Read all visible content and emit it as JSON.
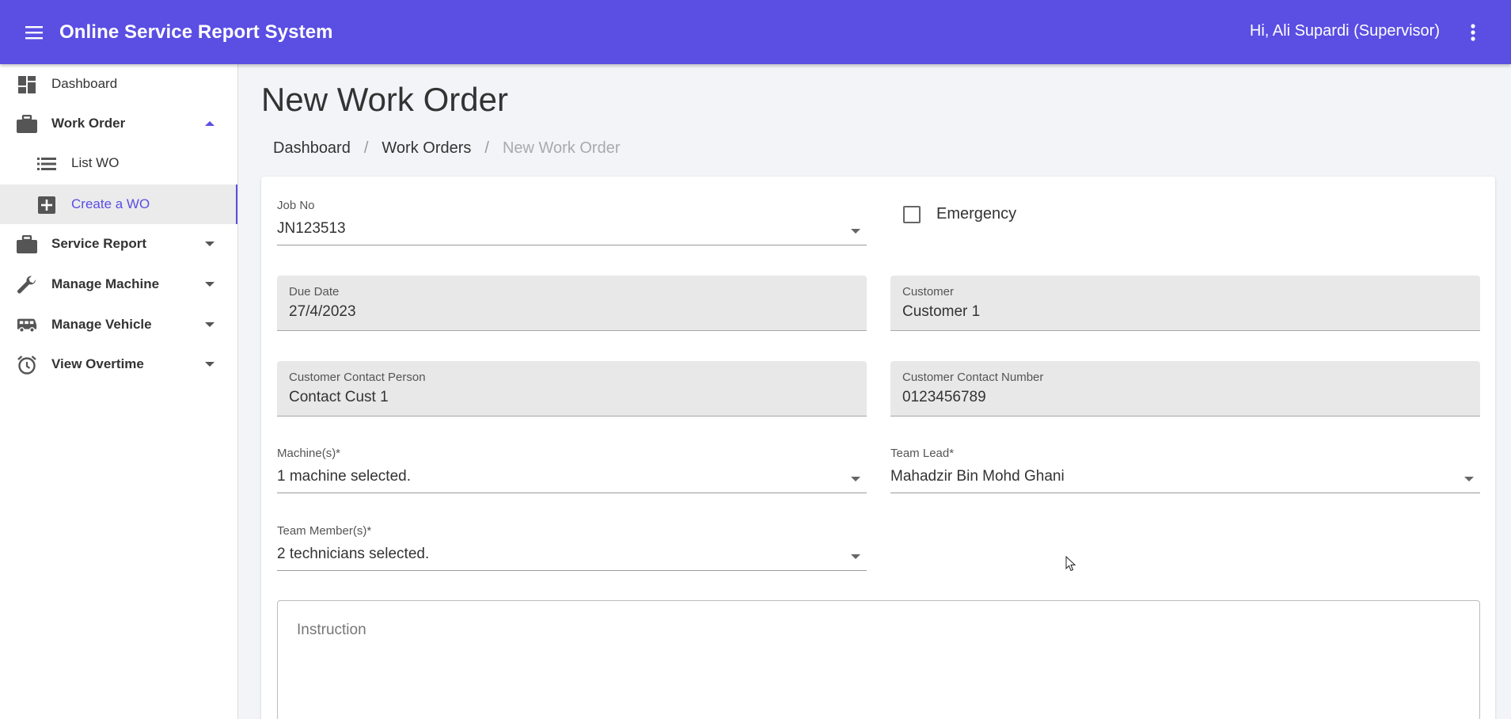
{
  "appbar": {
    "title": "Online Service Report System",
    "greeting": "Hi, Ali Supardi (Supervisor)",
    "color": "#5a4ee3"
  },
  "sidebar": {
    "items": [
      {
        "label": "Dashboard",
        "icon": "dashboard-icon"
      },
      {
        "label": "Work Order",
        "icon": "briefcase-icon",
        "expanded": true
      },
      {
        "label": "List WO",
        "icon": "list-icon"
      },
      {
        "label": "Create a WO",
        "icon": "add-box-icon",
        "active": true
      },
      {
        "label": "Service Report",
        "icon": "briefcase-icon"
      },
      {
        "label": "Manage Machine",
        "icon": "wrench-icon"
      },
      {
        "label": "Manage Vehicle",
        "icon": "bus-icon"
      },
      {
        "label": "View Overtime",
        "icon": "alarm-clock-icon"
      }
    ]
  },
  "main": {
    "page_title": "New Work Order",
    "breadcrumb": [
      "Dashboard",
      "Work Orders",
      "New Work Order"
    ],
    "breadcrumb_sep": "/"
  },
  "form": {
    "job_no": {
      "label": "Job No",
      "value": "JN123513"
    },
    "emergency": {
      "label": "Emergency",
      "checked": false
    },
    "due_date": {
      "label": "Due Date",
      "value": "27/4/2023"
    },
    "customer": {
      "label": "Customer",
      "value": "Customer 1"
    },
    "contact_person": {
      "label": "Customer Contact Person",
      "value": "Contact Cust 1"
    },
    "contact_number": {
      "label": "Customer Contact Number",
      "value": "0123456789"
    },
    "machines": {
      "label": "Machine(s)*",
      "value": "1 machine selected."
    },
    "team_lead": {
      "label": "Team Lead*",
      "value": "Mahadzir Bin Mohd Ghani"
    },
    "team_members": {
      "label": "Team Member(s)*",
      "value": "2 technicians selected."
    },
    "instruction": {
      "placeholder": "Instruction"
    }
  }
}
